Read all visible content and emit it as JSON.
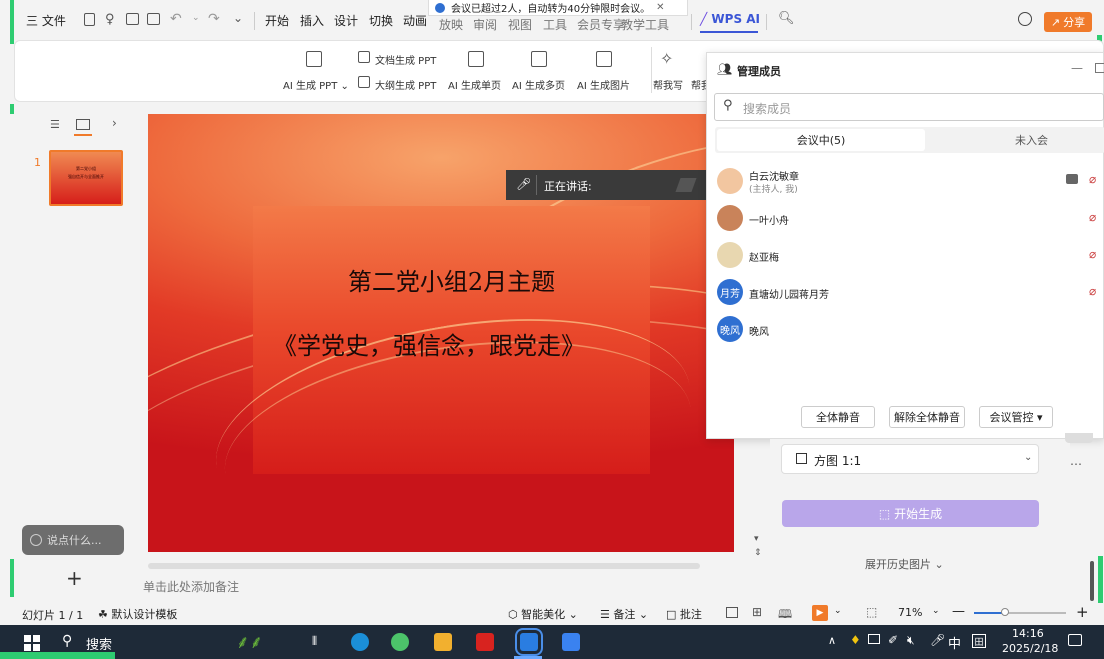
{
  "menu": {
    "hamburger": "三 文件",
    "items": [
      "开始",
      "插入",
      "设计",
      "切换",
      "动画",
      "放映",
      "审阅",
      "视图",
      "工具",
      "会员专享",
      "教学工具"
    ],
    "wps_ai": "WPS AI",
    "share": "分享"
  },
  "notice": "会议已超过2人，自动转为40分钟限时会议。",
  "ribbon": {
    "ai_ppt": "AI 生成 PPT",
    "doc_ppt": "文档生成 PPT",
    "outline_ppt": "大纲生成 PPT",
    "single_page": "AI 生成单页",
    "multi_page": "AI 生成多页",
    "image": "AI 生成图片",
    "help_write": "帮我写",
    "help_more": "帮我"
  },
  "thumbs": {
    "index": "1",
    "thumb_title": "第二党小组",
    "thumb_sub": "强自信开与全面推开"
  },
  "slide": {
    "title": "第二党小组2月主题",
    "subtitle": "《学党史，强信念，跟党走》"
  },
  "speaking": {
    "label": "正在讲话:"
  },
  "meeting": {
    "header": "管理成员",
    "search_placeholder": "搜索成员",
    "tab_in": "会议中(5)",
    "tab_out": "未入会",
    "members": [
      {
        "name": "白云沈敏章",
        "sub": "(主持人, 我)",
        "avatar": "",
        "color": "#f2c6a0"
      },
      {
        "name": "一叶小舟",
        "sub": "",
        "avatar": "",
        "color": "#c9835a"
      },
      {
        "name": "赵亚梅",
        "sub": "",
        "avatar": "",
        "color": "#e8d7b0"
      },
      {
        "name": "直塘幼儿园蒋月芳",
        "sub": "",
        "avatar": "月芳",
        "color": "#2f6fd1"
      },
      {
        "name": "晚风",
        "sub": "",
        "avatar": "晚风",
        "color": "#2f6fd1"
      }
    ],
    "btn_mute_all": "全体静音",
    "btn_unmute_all": "解除全体静音",
    "btn_control": "会议管控"
  },
  "right": {
    "ratio": "方图 1:1",
    "generate": "开始生成",
    "history": "展开历史图片"
  },
  "notes_placeholder": "单击此处添加备注",
  "comment_placeholder": "说点什么...",
  "statusbar": {
    "slide_count": "幻灯片 1 / 1",
    "template": "默认设计模板",
    "beautify": "智能美化",
    "notes": "备注",
    "comments": "批注",
    "zoom": "71%"
  },
  "taskbar": {
    "search": "搜索",
    "ime": "中",
    "time": "14:16",
    "date": "2025/2/18"
  },
  "colors": {
    "accent_orange": "#f07a2a",
    "generate_btn": "#b9a6ea",
    "taskbar": "#1e2a38"
  }
}
